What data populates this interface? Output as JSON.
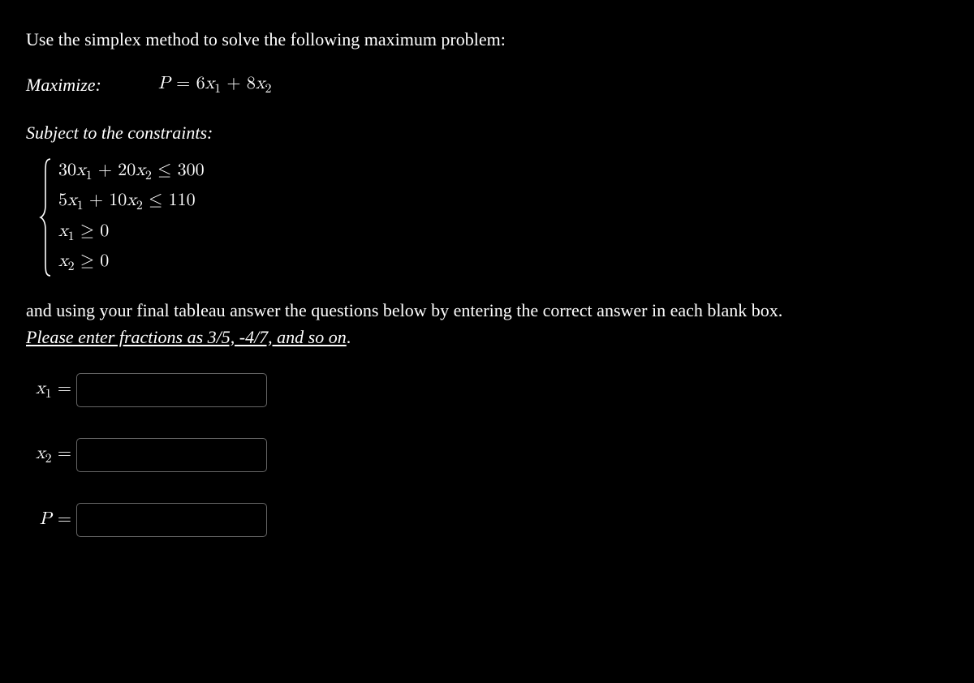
{
  "problem": {
    "intro": "Use the simplex method to solve the following maximum problem:",
    "maximize_label": "Maximize:",
    "objective_html": "<span class='var'>P</span> = 6<span class='var'>x</span><sub>1</sub> + 8<span class='var'>x</span><sub>2</sub>",
    "subject_label": "Subject to the constraints:",
    "constraints_html": [
      "30<span class='var'>x</span><sub>1</sub> + 20<span class='var'>x</span><sub>2</sub> ≤ 300",
      "5<span class='var'>x</span><sub>1</sub> + 10<span class='var'>x</span><sub>2</sub> ≤ 110",
      "<span class='var'>x</span><sub>1</sub> ≥ 0",
      "<span class='var'>x</span><sub>2</sub> ≥ 0"
    ],
    "instruction_plain": "and using your final tableau answer the questions below by entering the correct answer in each blank box.",
    "instruction_emph": "Please enter fractions as  3/5,  -4/7, and so on",
    "instruction_period": "."
  },
  "answers": {
    "x1_label_html": "<span class='var'>x</span><sub>1</sub> =",
    "x2_label_html": "<span class='var'>x</span><sub>2</sub> =",
    "p_label_html": "<span class='var'>P</span> =",
    "x1_value": "",
    "x2_value": "",
    "p_value": ""
  }
}
